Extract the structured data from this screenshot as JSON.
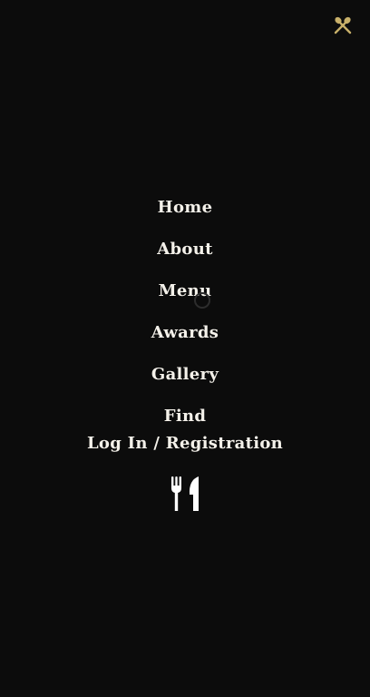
{
  "menu": {
    "items": [
      {
        "label": "Home"
      },
      {
        "label": "About"
      },
      {
        "label": "Menu"
      },
      {
        "label": "Awards"
      },
      {
        "label": "Gallery"
      },
      {
        "label": "Find"
      }
    ],
    "login_label": "Log In / Registration"
  },
  "icons": {
    "close": "close-cutlery-icon",
    "spinner": "loading-spinner",
    "cutlery": "fork-knife-icon"
  },
  "colors": {
    "background": "#0c0c0c",
    "accent": "#c8b06a",
    "text": "#f4f1ea"
  }
}
